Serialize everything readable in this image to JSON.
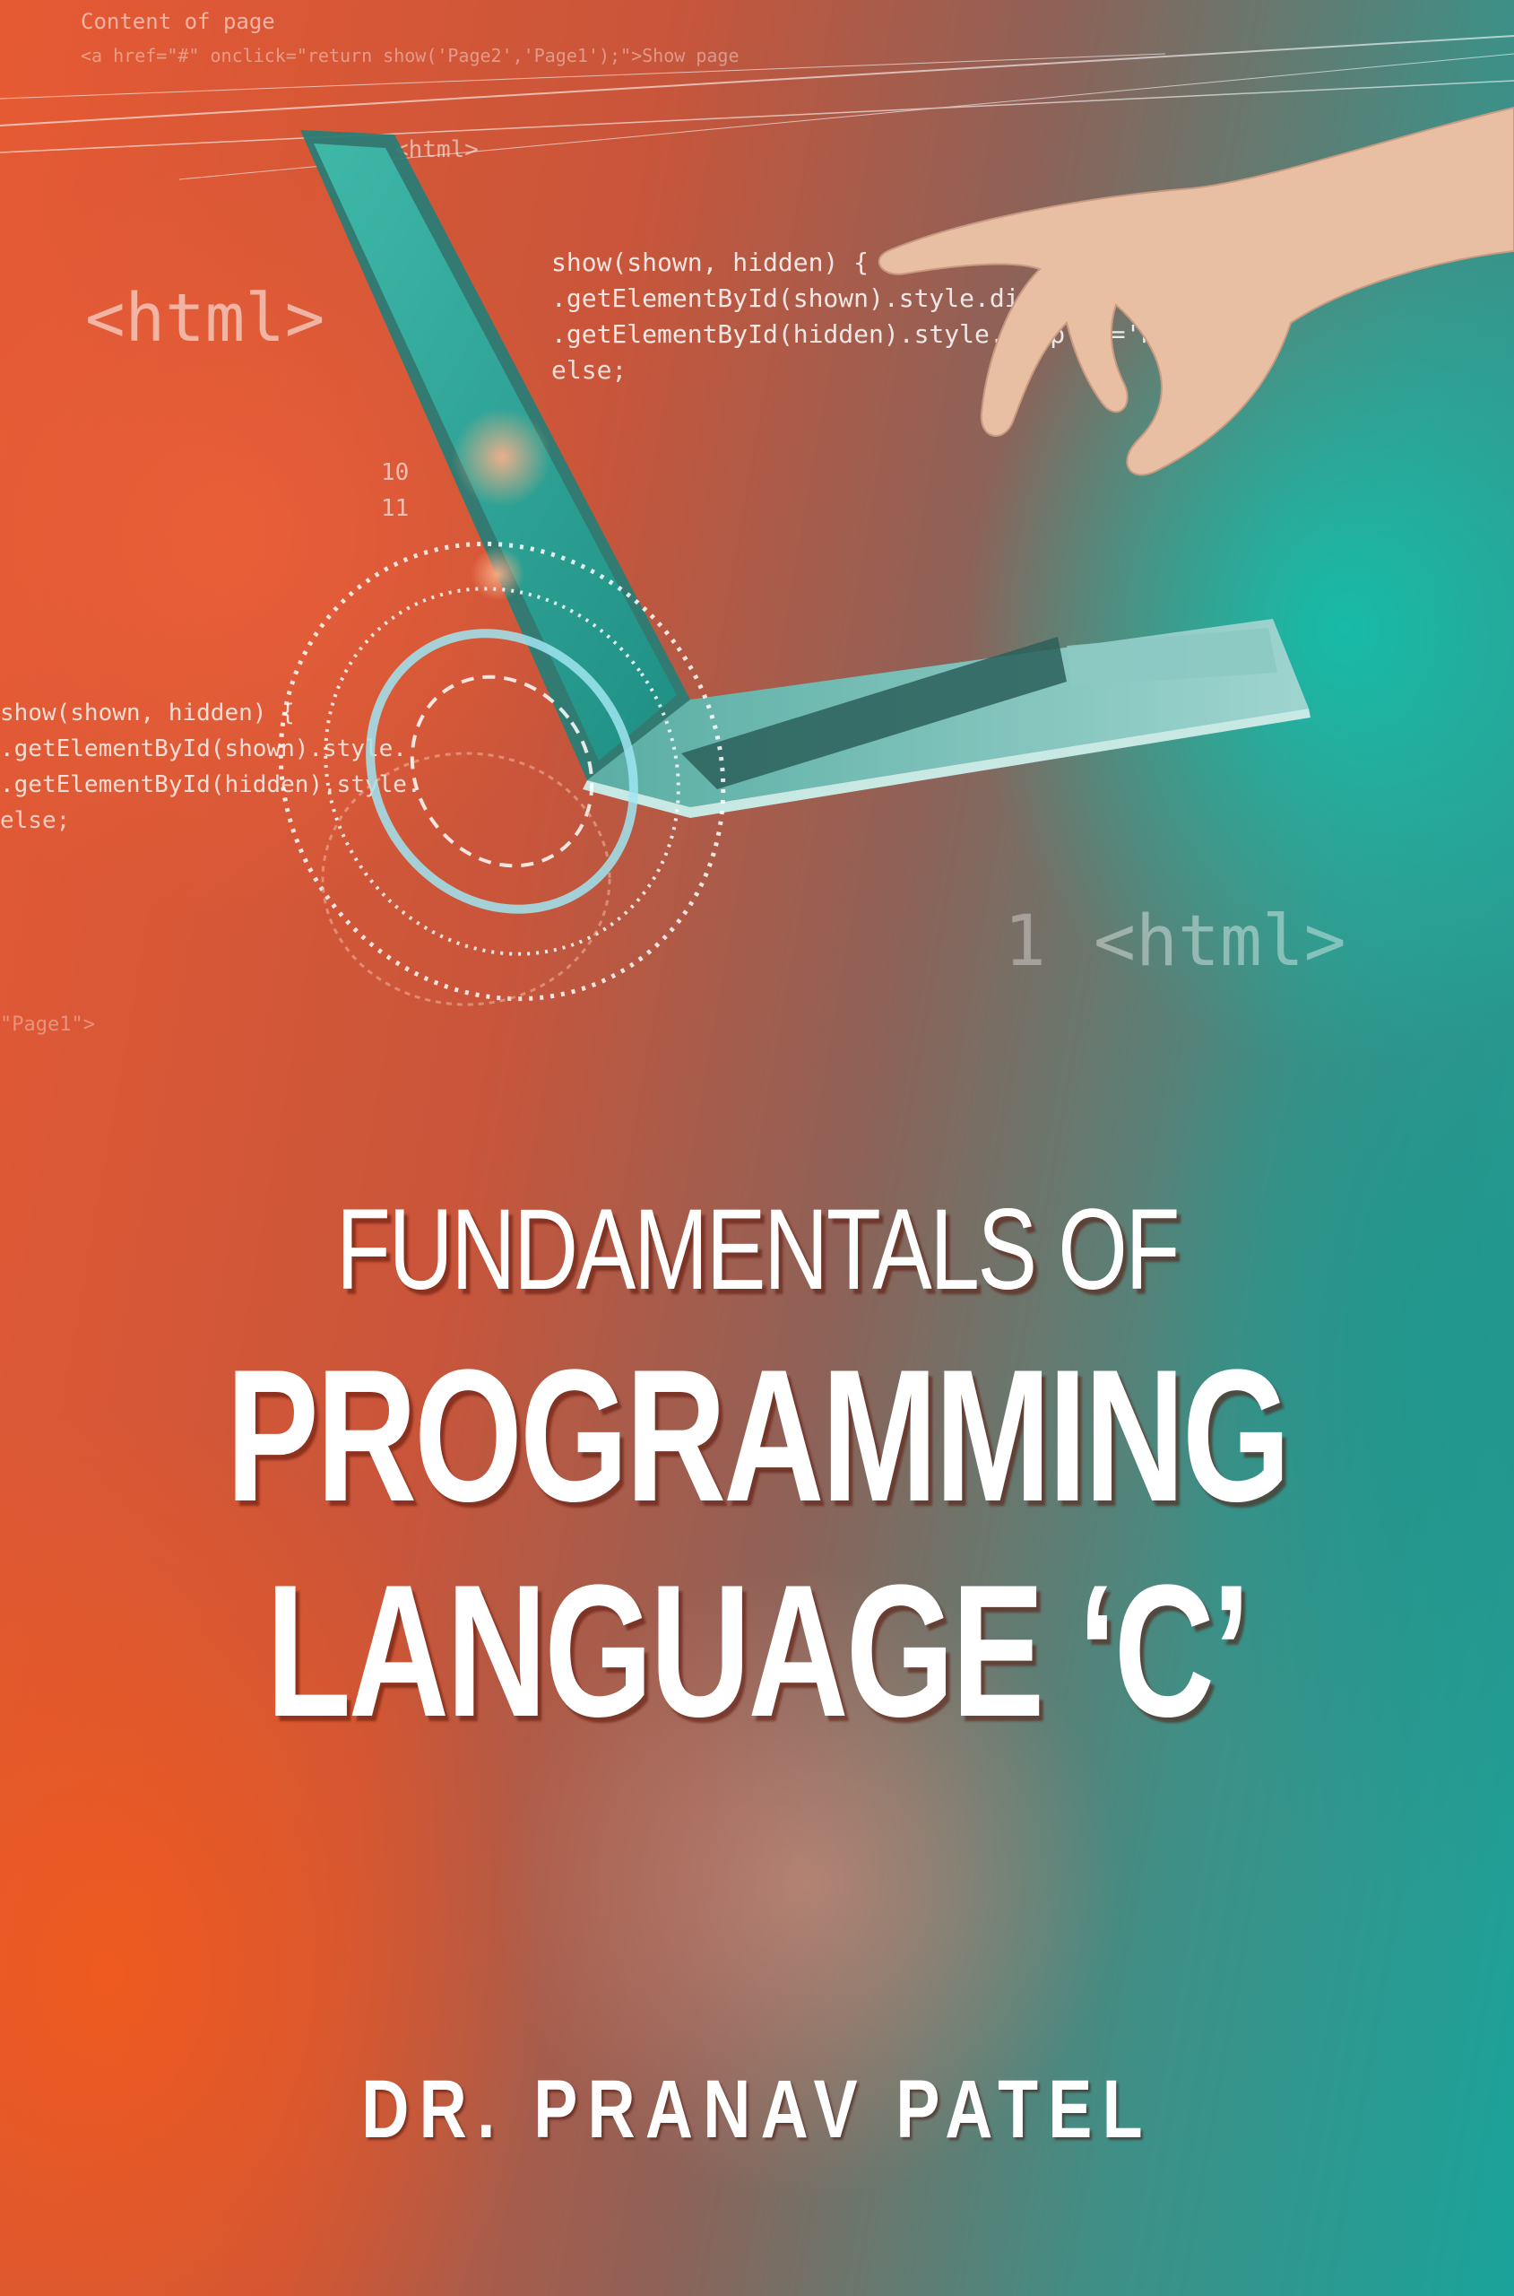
{
  "cover": {
    "title_line1": "FUNDAMENTALS OF",
    "title_line2": "PROGRAMMING",
    "title_line3": "LANGUAGE ‘C’",
    "author": "DR. PRANAV PATEL"
  },
  "background_code": {
    "lines": [
      "Content of page",
      "<a href=\"#\" onclick=\"return show('Page2','Page1');\">Show page",
      "<html>",
      "show(shown, hidden) {",
      ".getElementById(shown).style.display='block';",
      ".getElementById(hidden).style.display='none';",
      "else;",
      "10",
      "11",
      "show(shown, hidden) {",
      ".getElementById(shown).style.",
      ".getElementById(hidden).style.",
      "else;",
      "\"Page1\">"
    ],
    "big_tag_left": "<html>",
    "big_tag_right_number": "1",
    "big_tag_right": "<html>"
  },
  "colors": {
    "left_accent": "#e65a33",
    "right_accent": "#1aa39a",
    "title_text": "#ffffff"
  },
  "icons": [
    "laptop-illustration",
    "hand-illustration",
    "fingerprint-circle-illustration"
  ]
}
